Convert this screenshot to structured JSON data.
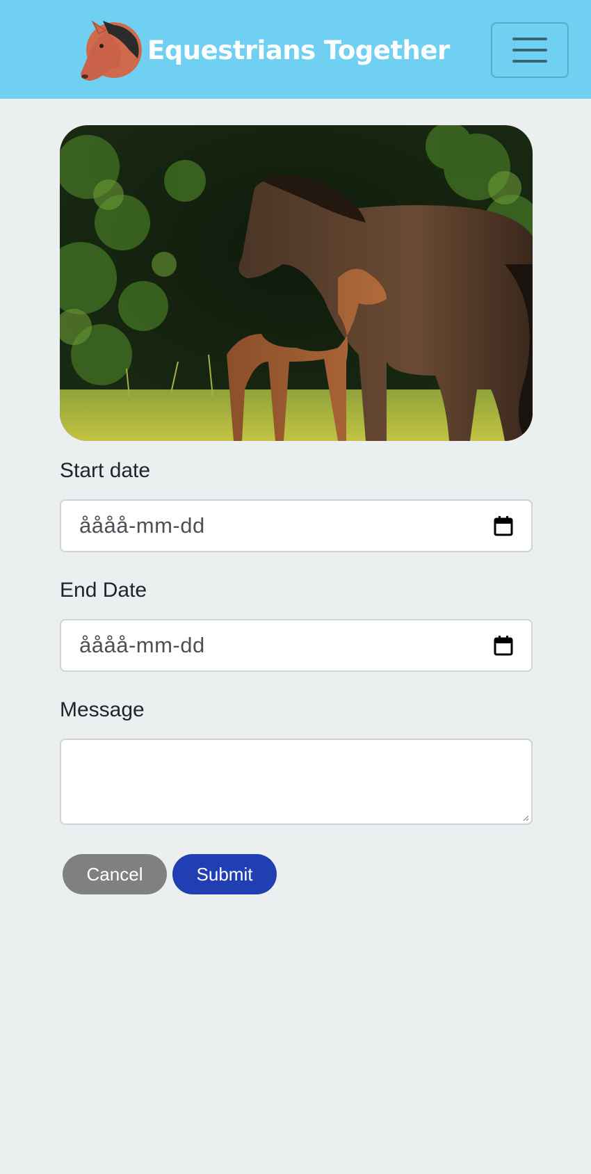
{
  "header": {
    "brand_name": "Equestrians Together",
    "logo_icon": "horse-head-icon",
    "menu_icon": "hamburger-menu-icon",
    "background_color": "#6fd0f2"
  },
  "hero": {
    "image_subject": "mare and foal in a meadow"
  },
  "form": {
    "start_date": {
      "label": "Start date",
      "value": "åååå-mm-dd",
      "icon": "calendar-icon"
    },
    "end_date": {
      "label": "End Date",
      "value": "åååå-mm-dd",
      "icon": "calendar-icon"
    },
    "message": {
      "label": "Message",
      "value": ""
    },
    "cancel_label": "Cancel",
    "submit_label": "Submit",
    "cancel_color": "#808080",
    "submit_color": "#213fb2"
  }
}
